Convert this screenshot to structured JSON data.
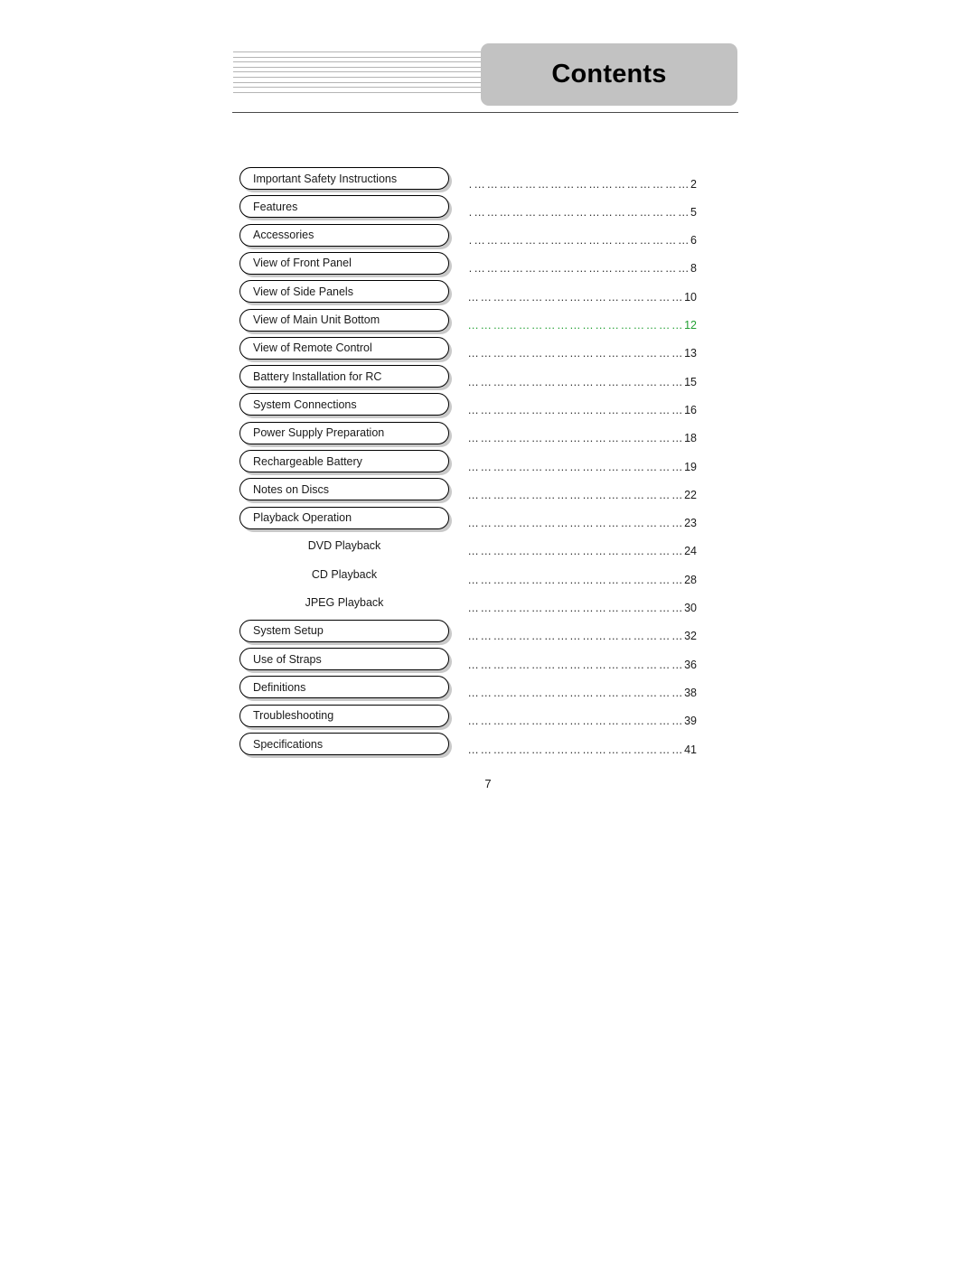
{
  "header": {
    "title": "Contents",
    "decoration_line_count": 9,
    "band_color": "#c2c2c2",
    "rule_color": "#4a4a4a"
  },
  "colors": {
    "text": "#1a1a1a",
    "highlight": "#22a033",
    "box_border": "#000000",
    "box_shadow": "#c9c9c9",
    "leader": "#2a2a2a"
  },
  "toc": {
    "leader_char": "…",
    "entries": [
      {
        "label": "Important Safety Instructions",
        "page": "2",
        "boxed": true,
        "highlight": false
      },
      {
        "label": "Features",
        "page": "5",
        "boxed": true,
        "highlight": false
      },
      {
        "label": "Accessories",
        "page": "6",
        "boxed": true,
        "highlight": false
      },
      {
        "label": "View of Front Panel",
        "page": "8",
        "boxed": true,
        "highlight": false
      },
      {
        "label": "View of Side Panels",
        "page": "10",
        "boxed": true,
        "highlight": false
      },
      {
        "label": "View of Main Unit Bottom",
        "page": "12",
        "boxed": true,
        "highlight": true
      },
      {
        "label": "View of Remote Control",
        "page": "13",
        "boxed": true,
        "highlight": false
      },
      {
        "label": "Battery Installation for RC",
        "page": "15",
        "boxed": true,
        "highlight": false
      },
      {
        "label": "System Connections",
        "page": "16",
        "boxed": true,
        "highlight": false
      },
      {
        "label": "Power Supply Preparation",
        "page": "18",
        "boxed": true,
        "highlight": false
      },
      {
        "label": "Rechargeable Battery",
        "page": "19",
        "boxed": true,
        "highlight": false
      },
      {
        "label": "Notes on Discs",
        "page": "22",
        "boxed": true,
        "highlight": false
      },
      {
        "label": "Playback Operation",
        "page": "23",
        "boxed": true,
        "highlight": false
      },
      {
        "label": "DVD Playback",
        "page": "24",
        "boxed": false,
        "highlight": false
      },
      {
        "label": "CD Playback",
        "page": "28",
        "boxed": false,
        "highlight": false
      },
      {
        "label": "JPEG Playback",
        "page": "30",
        "boxed": false,
        "highlight": false
      },
      {
        "label": "System Setup",
        "page": "32",
        "boxed": true,
        "highlight": false
      },
      {
        "label": "Use of Straps",
        "page": "36",
        "boxed": true,
        "highlight": false
      },
      {
        "label": "Definitions",
        "page": "38",
        "boxed": true,
        "highlight": false
      },
      {
        "label": "Troubleshooting",
        "page": "39",
        "boxed": true,
        "highlight": false
      },
      {
        "label": "Specifications",
        "page": "41",
        "boxed": true,
        "highlight": false
      }
    ]
  },
  "footer": {
    "page_number": "7"
  }
}
